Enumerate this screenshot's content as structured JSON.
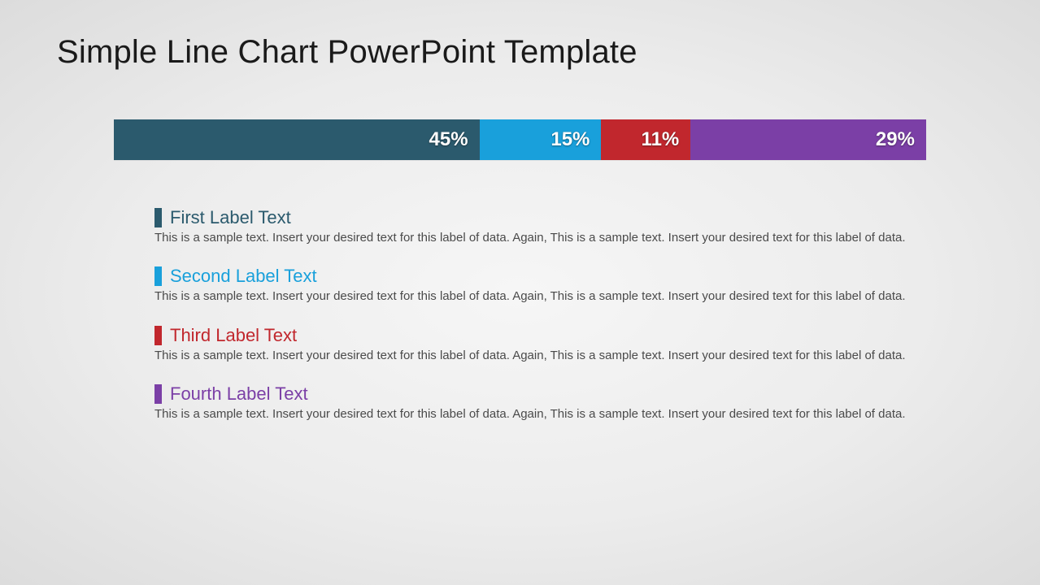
{
  "title": "Simple Line Chart PowerPoint Template",
  "chart_data": {
    "type": "bar",
    "orientation": "stacked-horizontal",
    "categories": [
      "First Label Text",
      "Second Label Text",
      "Third Label Text",
      "Fourth Label Text"
    ],
    "values": [
      45,
      15,
      11,
      29
    ],
    "unit": "%",
    "colors": [
      "#2b5a6d",
      "#19a0db",
      "#c1272d",
      "#7b3fa6"
    ]
  },
  "segments": [
    {
      "value_label": "45%",
      "color": "#2b5a6d",
      "width": 45
    },
    {
      "value_label": "15%",
      "color": "#19a0db",
      "width": 15
    },
    {
      "value_label": "11%",
      "color": "#c1272d",
      "width": 11
    },
    {
      "value_label": "29%",
      "color": "#7b3fa6",
      "width": 29
    }
  ],
  "legend": [
    {
      "title": "First Label Text",
      "color": "#2b5a6d",
      "desc": "This is a sample text. Insert your desired text for this label of data. Again, This is a sample text. Insert your desired text for this label of data."
    },
    {
      "title": "Second Label Text",
      "color": "#19a0db",
      "desc": "This is a sample text. Insert your desired text for this label of data. Again, This is a sample text. Insert your desired text for this label of data."
    },
    {
      "title": "Third Label Text",
      "color": "#c1272d",
      "desc": "This is a sample text. Insert your desired text for this label of data. Again, This is a sample text. Insert your desired text for this label of data."
    },
    {
      "title": "Fourth Label Text",
      "color": "#7b3fa6",
      "desc": "This is a sample text. Insert your desired text for this label of data. Again, This is a sample text. Insert your desired text for this label of data."
    }
  ]
}
